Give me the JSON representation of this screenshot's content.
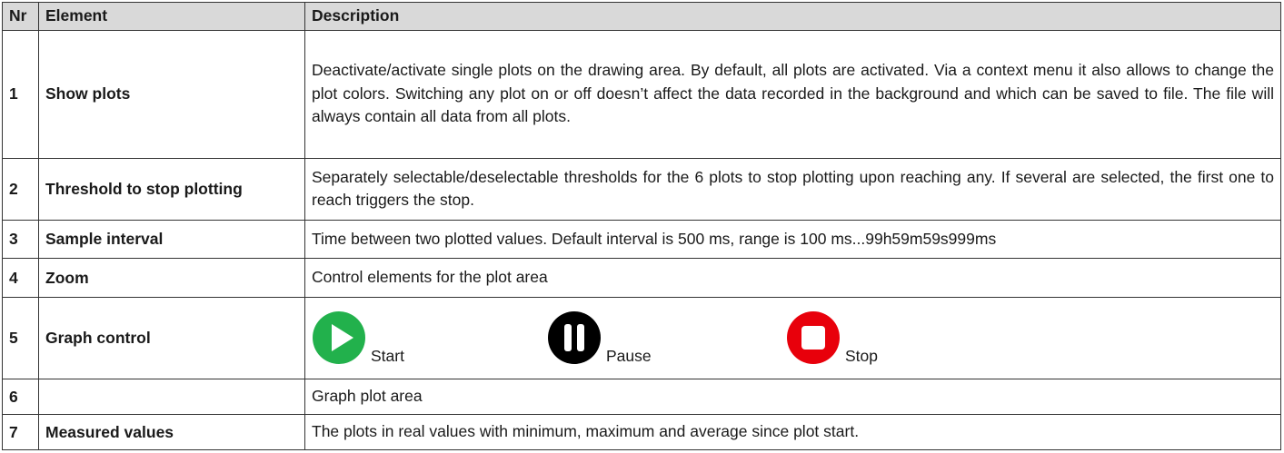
{
  "table": {
    "headers": {
      "nr": "Nr",
      "element": "Element",
      "description": "Description"
    },
    "rows": [
      {
        "nr": "1",
        "element": "Show plots",
        "description": "Deactivate/activate single plots on the drawing area. By default, all plots are activated. Via a context menu it also allows to change the plot colors. Switching any plot on or off doesn’t affect the data recorded in the background and which can be saved to file. The file will always contain all data from all plots."
      },
      {
        "nr": "2",
        "element": "Threshold to stop plotting",
        "description": "Separately selectable/deselectable thresholds for the 6 plots to stop plotting upon reaching any. If several are selected, the first one to reach triggers the stop."
      },
      {
        "nr": "3",
        "element": "Sample interval",
        "description": "Time between two plotted values. Default interval is 500 ms, range is 100 ms...99h59m59s999ms"
      },
      {
        "nr": "4",
        "element": "Zoom",
        "description": "Control elements for the plot area"
      },
      {
        "nr": "5",
        "element": "Graph control",
        "description": ""
      },
      {
        "nr": "6",
        "element": "",
        "description": "Graph plot area"
      },
      {
        "nr": "7",
        "element": "Measured values",
        "description": "The plots in real values with minimum, maximum and average since plot start."
      }
    ]
  },
  "graph_control": {
    "start": {
      "label": "Start",
      "icon": "play-icon",
      "color": "#22b14c"
    },
    "pause": {
      "label": "Pause",
      "icon": "pause-icon",
      "color": "#000000"
    },
    "stop": {
      "label": "Stop",
      "icon": "stop-icon",
      "color": "#e8000b"
    }
  }
}
